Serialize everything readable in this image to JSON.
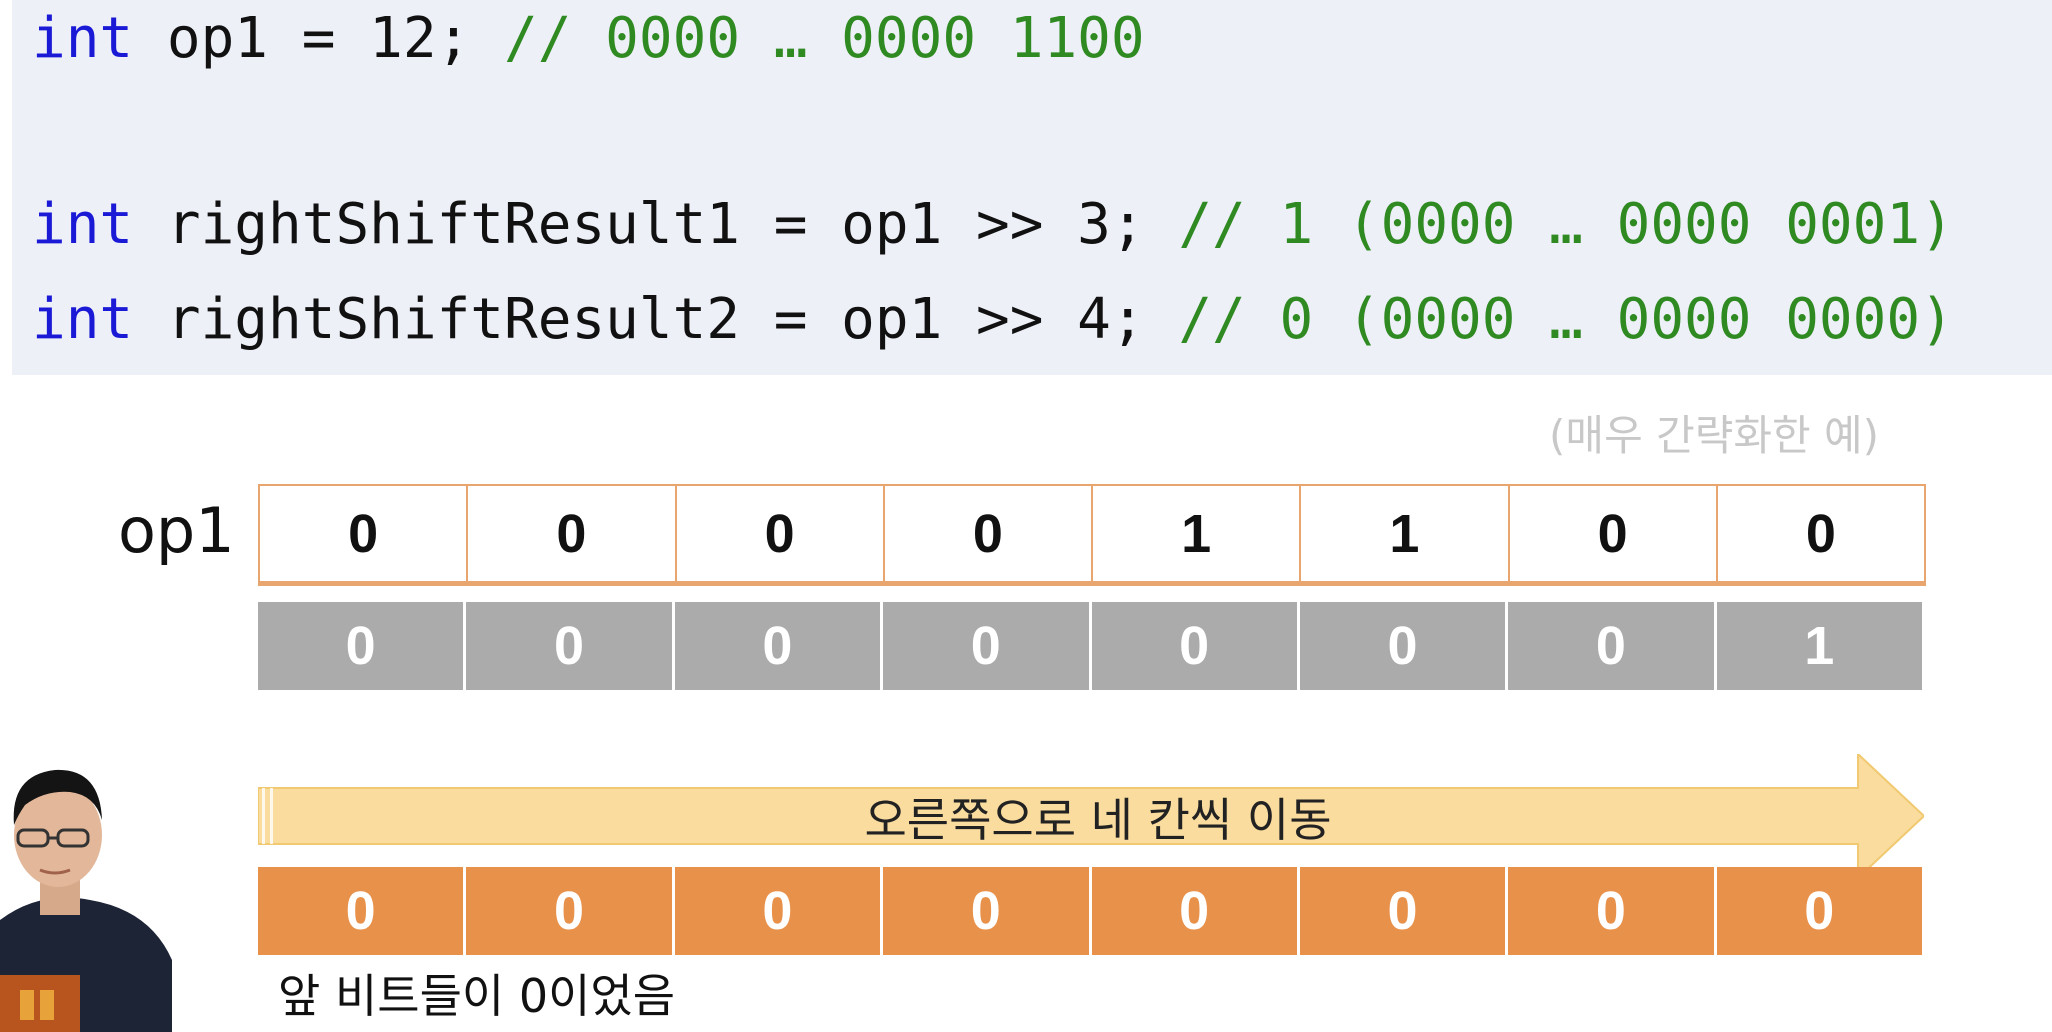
{
  "code": {
    "line1": {
      "kw": "int",
      "code": " op1 = 12; ",
      "comment": "// 0000 … 0000 1100"
    },
    "line2": {
      "kw": "int",
      "code": " rightShiftResult1 = op1 >> 3; ",
      "comment": "// 1 (0000 … 0000 0001)"
    },
    "line3": {
      "kw": "int",
      "code": " rightShiftResult2 = op1 >> 4; ",
      "comment": "// 0 (0000 … 0000 0000)"
    }
  },
  "note": "(매우 간략화한 예)",
  "row_label": "op1",
  "op1_bits": [
    "0",
    "0",
    "0",
    "0",
    "1",
    "1",
    "0",
    "0"
  ],
  "result1_bits": [
    "0",
    "0",
    "0",
    "0",
    "0",
    "0",
    "0",
    "1"
  ],
  "result2_bits": [
    "0",
    "0",
    "0",
    "0",
    "0",
    "0",
    "0",
    "0"
  ],
  "arrow_label": "오른쪽으로 네 칸씩 이동",
  "caption": "앞 비트들이 0이었음",
  "colors": {
    "code_bg": "#eef0f8",
    "keyword": "#1a1ad6",
    "comment": "#2f8a22",
    "op1_border": "#e9a56e",
    "result1_fill": "#ababab",
    "result2_fill": "#e8914a",
    "arrow_fill": "#f9dc9e"
  }
}
